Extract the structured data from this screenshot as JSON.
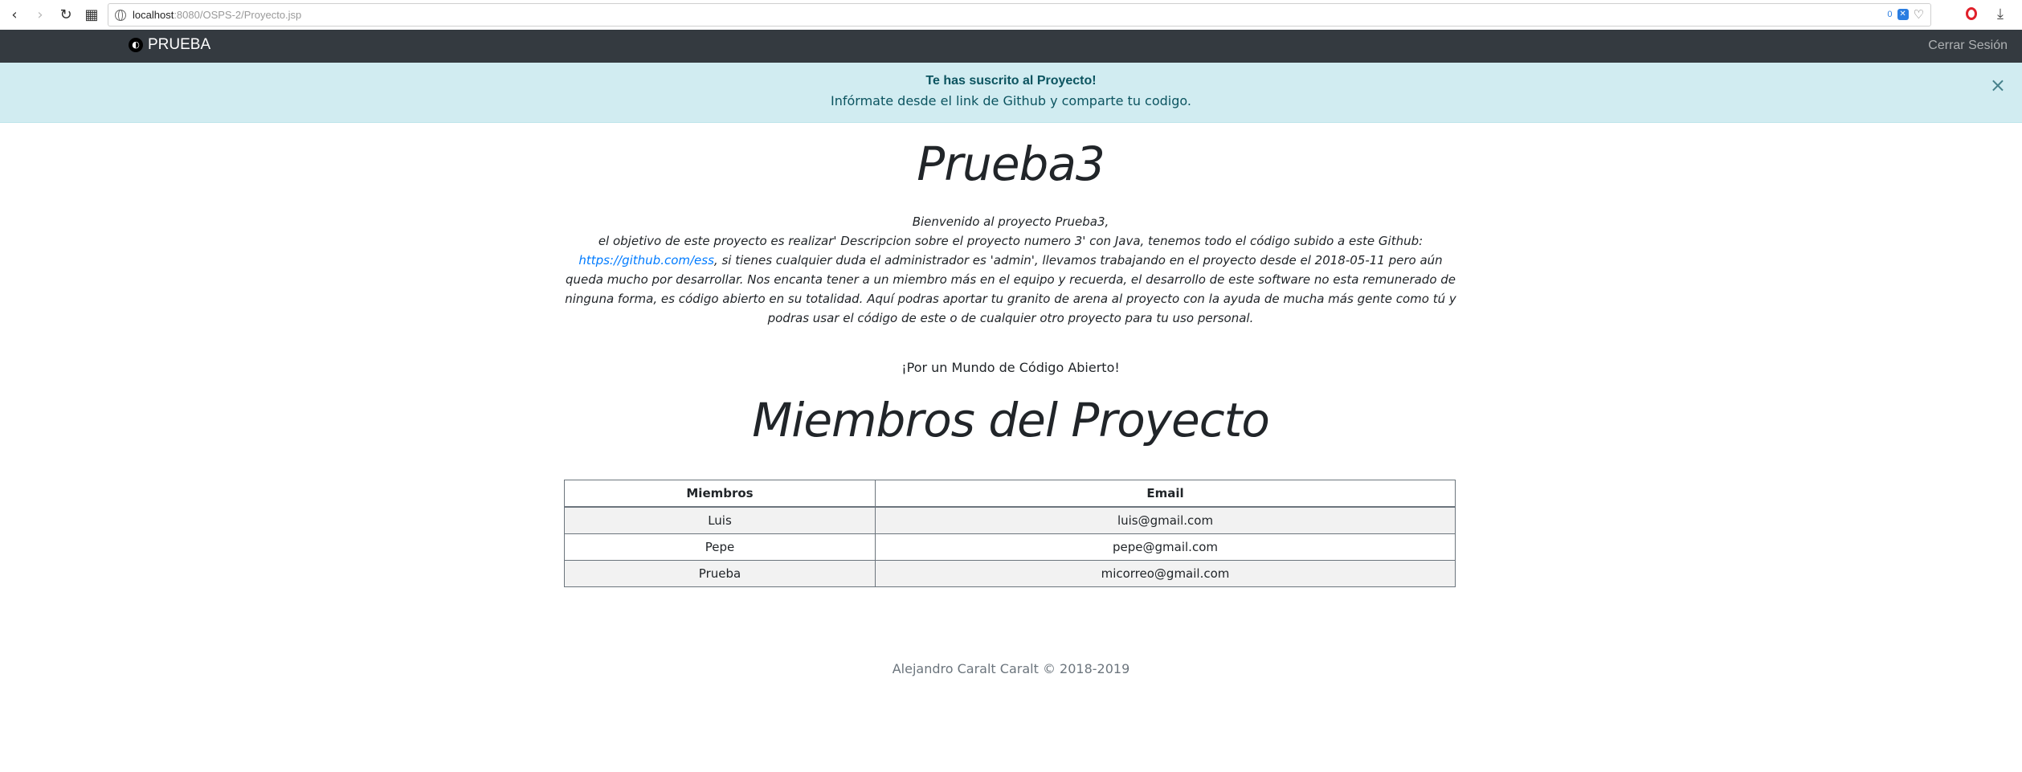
{
  "browser": {
    "url_host": "localhost",
    "url_path": ":8080/OSPS-2/Proyecto.jsp",
    "badge_count": "0"
  },
  "navbar": {
    "brand": "PRUEBA",
    "logout": "Cerrar Sesión"
  },
  "alert": {
    "title": "Te has suscrito al Proyecto!",
    "message": "Infórmate desde el link de Github y comparte tu codigo.",
    "close": "×"
  },
  "project": {
    "title": "Prueba3",
    "greeting": "Bienvenido al proyecto Prueba3,",
    "desc_before_link": "el objetivo de este proyecto es realizar' Descripcion sobre el proyecto numero 3' con Java, tenemos todo el código subido a este Github: ",
    "link": "https://github.com/ess",
    "desc_after_link": ", si tienes cualquier duda el administrador es 'admin', llevamos trabajando en el proyecto desde el 2018-05-11 pero aún queda mucho por desarrollar. Nos encanta tener a un miembro más en el equipo y recuerda, el desarrollo de este software no esta remunerado de ninguna forma, es código abierto en su totalidad. Aquí podras aportar tu granito de arena al proyecto con la ayuda de mucha más gente como tú y podras usar el código de este o de cualquier otro proyecto para tu uso personal.",
    "motto": "¡Por un Mundo de Código Abierto!"
  },
  "members": {
    "title": "Miembros del Proyecto",
    "headers": [
      "Miembros",
      "Email"
    ],
    "rows": [
      {
        "name": "Luis",
        "email": "luis@gmail.com"
      },
      {
        "name": "Pepe",
        "email": "pepe@gmail.com"
      },
      {
        "name": "Prueba",
        "email": "micorreo@gmail.com"
      }
    ]
  },
  "footer": "Alejandro Caralt Caralt © 2018-2019"
}
